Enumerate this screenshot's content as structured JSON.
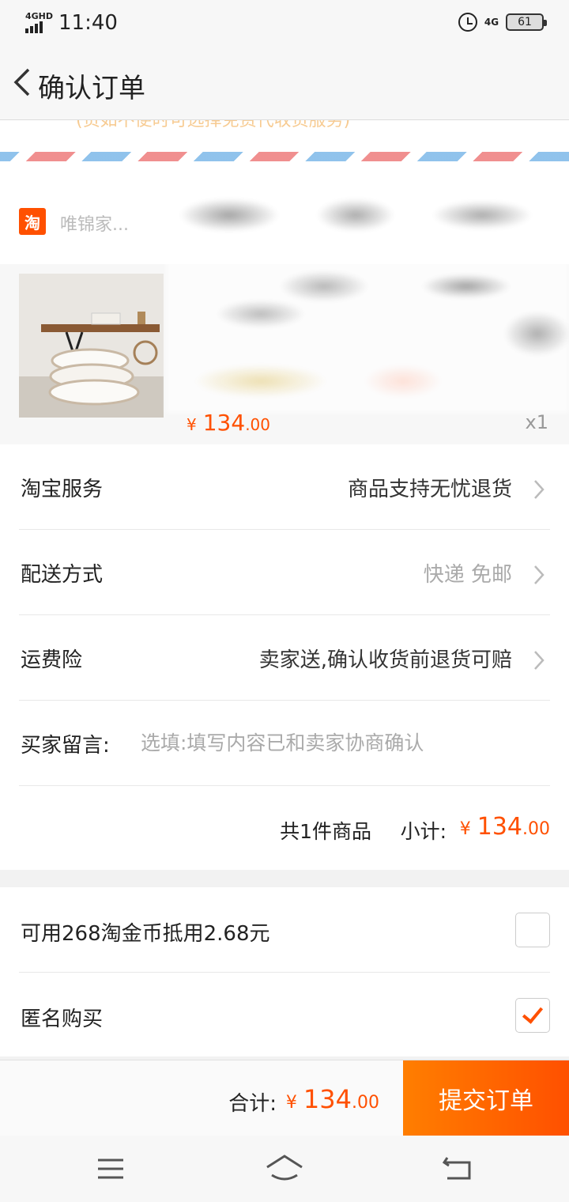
{
  "status_bar": {
    "network": "4GHD",
    "time": "11:40",
    "network_right": "4G",
    "battery": "61"
  },
  "nav": {
    "title": "确认订单"
  },
  "address": {
    "hint": "(货如不便时可选择免费代收货服务)"
  },
  "shop": {
    "icon_label": "淘",
    "name": "唯锦家..."
  },
  "product": {
    "price_currency": "¥",
    "price_int": "134",
    "price_dec": ".00",
    "quantity": "x1"
  },
  "details": {
    "service_label": "淘宝服务",
    "service_value": "商品支持无忧退货",
    "delivery_label": "配送方式",
    "delivery_value": "快递 免邮",
    "insurance_label": "运费险",
    "insurance_value": "卖家送,确认收货前退货可赔",
    "message_label": "买家留言:",
    "message_placeholder": "选填:填写内容已和卖家协商确认",
    "message_value": "",
    "subtotal_count": "共1件商品",
    "subtotal_label": "小计:",
    "subtotal_currency": "¥",
    "subtotal_int": "134",
    "subtotal_dec": ".00"
  },
  "options": {
    "coins_label": "可用268淘金币抵用2.68元",
    "coins_checked": false,
    "anonymous_label": "匿名购买",
    "anonymous_checked": true
  },
  "bottom": {
    "total_label": "合计:",
    "total_currency": "¥",
    "total_int": "134",
    "total_dec": ".00",
    "submit_label": "提交订单"
  },
  "colors": {
    "accent": "#ff5000",
    "button_gradient_start": "#ff7e00"
  },
  "icons": {
    "back": "chevron-left-icon",
    "row_arrow": "chevron-right-icon",
    "menu": "menu-icon",
    "home": "home-icon",
    "return": "return-icon"
  }
}
